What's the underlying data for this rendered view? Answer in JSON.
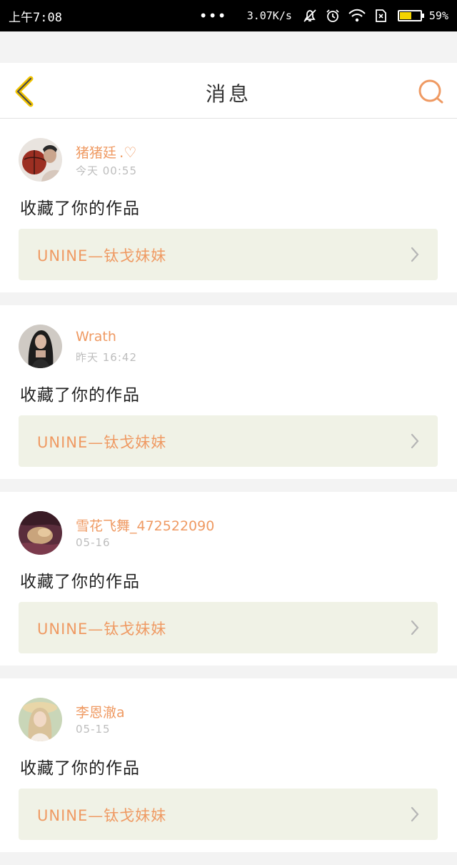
{
  "status_bar": {
    "time": "上午7:08",
    "network_speed": "3.07K/s",
    "battery_percent": "59%",
    "battery_level": 0.59,
    "battery_color": "#f4d400",
    "icons": [
      "silent-bell-icon",
      "alarm-icon",
      "wifi-icon",
      "sim-icon",
      "battery-icon"
    ]
  },
  "header": {
    "title": "消息",
    "back_icon": "chevron-left-icon",
    "search_icon": "search-icon"
  },
  "colors": {
    "accent": "#ef9a63",
    "back_icon": "#f2c400",
    "link_background": "#f0f2e6"
  },
  "messages": [
    {
      "username": "猪猪廷",
      "username_suffix": ".♡",
      "time": "今天 00:55",
      "text": "收藏了你的作品",
      "work_title": "UNINE—钛戈妹妹"
    },
    {
      "username": "Wrath",
      "username_suffix": "",
      "time": "昨天 16:42",
      "text": "收藏了你的作品",
      "work_title": "UNINE—钛戈妹妹"
    },
    {
      "username": "雪花飞舞_472522090",
      "username_suffix": "",
      "time": "05-16",
      "text": "收藏了你的作品",
      "work_title": "UNINE—钛戈妹妹"
    },
    {
      "username": "李恩澈a",
      "username_suffix": "",
      "time": "05-15",
      "text": "收藏了你的作品",
      "work_title": "UNINE—钛戈妹妹"
    }
  ]
}
